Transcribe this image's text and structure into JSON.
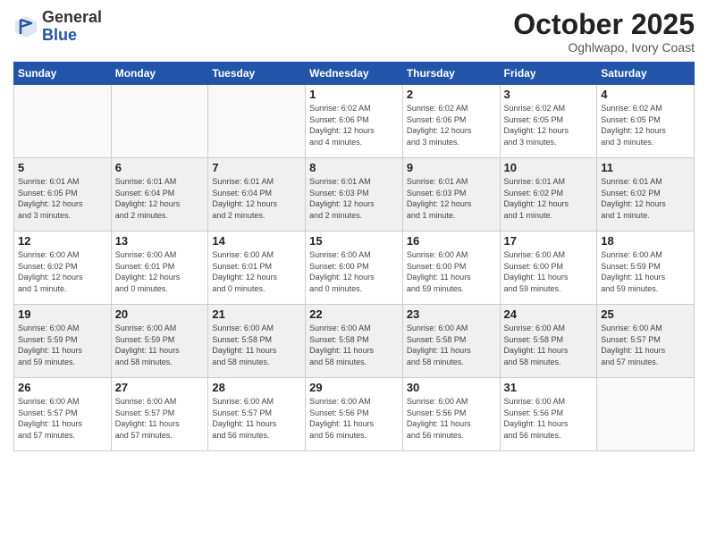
{
  "logo": {
    "general": "General",
    "blue": "Blue"
  },
  "header": {
    "month": "October 2025",
    "location": "Oghlwapo, Ivory Coast"
  },
  "weekdays": [
    "Sunday",
    "Monday",
    "Tuesday",
    "Wednesday",
    "Thursday",
    "Friday",
    "Saturday"
  ],
  "weeks": [
    [
      {
        "day": "",
        "info": ""
      },
      {
        "day": "",
        "info": ""
      },
      {
        "day": "",
        "info": ""
      },
      {
        "day": "1",
        "info": "Sunrise: 6:02 AM\nSunset: 6:06 PM\nDaylight: 12 hours\nand 4 minutes."
      },
      {
        "day": "2",
        "info": "Sunrise: 6:02 AM\nSunset: 6:06 PM\nDaylight: 12 hours\nand 3 minutes."
      },
      {
        "day": "3",
        "info": "Sunrise: 6:02 AM\nSunset: 6:05 PM\nDaylight: 12 hours\nand 3 minutes."
      },
      {
        "day": "4",
        "info": "Sunrise: 6:02 AM\nSunset: 6:05 PM\nDaylight: 12 hours\nand 3 minutes."
      }
    ],
    [
      {
        "day": "5",
        "info": "Sunrise: 6:01 AM\nSunset: 6:05 PM\nDaylight: 12 hours\nand 3 minutes."
      },
      {
        "day": "6",
        "info": "Sunrise: 6:01 AM\nSunset: 6:04 PM\nDaylight: 12 hours\nand 2 minutes."
      },
      {
        "day": "7",
        "info": "Sunrise: 6:01 AM\nSunset: 6:04 PM\nDaylight: 12 hours\nand 2 minutes."
      },
      {
        "day": "8",
        "info": "Sunrise: 6:01 AM\nSunset: 6:03 PM\nDaylight: 12 hours\nand 2 minutes."
      },
      {
        "day": "9",
        "info": "Sunrise: 6:01 AM\nSunset: 6:03 PM\nDaylight: 12 hours\nand 1 minute."
      },
      {
        "day": "10",
        "info": "Sunrise: 6:01 AM\nSunset: 6:02 PM\nDaylight: 12 hours\nand 1 minute."
      },
      {
        "day": "11",
        "info": "Sunrise: 6:01 AM\nSunset: 6:02 PM\nDaylight: 12 hours\nand 1 minute."
      }
    ],
    [
      {
        "day": "12",
        "info": "Sunrise: 6:00 AM\nSunset: 6:02 PM\nDaylight: 12 hours\nand 1 minute."
      },
      {
        "day": "13",
        "info": "Sunrise: 6:00 AM\nSunset: 6:01 PM\nDaylight: 12 hours\nand 0 minutes."
      },
      {
        "day": "14",
        "info": "Sunrise: 6:00 AM\nSunset: 6:01 PM\nDaylight: 12 hours\nand 0 minutes."
      },
      {
        "day": "15",
        "info": "Sunrise: 6:00 AM\nSunset: 6:00 PM\nDaylight: 12 hours\nand 0 minutes."
      },
      {
        "day": "16",
        "info": "Sunrise: 6:00 AM\nSunset: 6:00 PM\nDaylight: 11 hours\nand 59 minutes."
      },
      {
        "day": "17",
        "info": "Sunrise: 6:00 AM\nSunset: 6:00 PM\nDaylight: 11 hours\nand 59 minutes."
      },
      {
        "day": "18",
        "info": "Sunrise: 6:00 AM\nSunset: 5:59 PM\nDaylight: 11 hours\nand 59 minutes."
      }
    ],
    [
      {
        "day": "19",
        "info": "Sunrise: 6:00 AM\nSunset: 5:59 PM\nDaylight: 11 hours\nand 59 minutes."
      },
      {
        "day": "20",
        "info": "Sunrise: 6:00 AM\nSunset: 5:59 PM\nDaylight: 11 hours\nand 58 minutes."
      },
      {
        "day": "21",
        "info": "Sunrise: 6:00 AM\nSunset: 5:58 PM\nDaylight: 11 hours\nand 58 minutes."
      },
      {
        "day": "22",
        "info": "Sunrise: 6:00 AM\nSunset: 5:58 PM\nDaylight: 11 hours\nand 58 minutes."
      },
      {
        "day": "23",
        "info": "Sunrise: 6:00 AM\nSunset: 5:58 PM\nDaylight: 11 hours\nand 58 minutes."
      },
      {
        "day": "24",
        "info": "Sunrise: 6:00 AM\nSunset: 5:58 PM\nDaylight: 11 hours\nand 58 minutes."
      },
      {
        "day": "25",
        "info": "Sunrise: 6:00 AM\nSunset: 5:57 PM\nDaylight: 11 hours\nand 57 minutes."
      }
    ],
    [
      {
        "day": "26",
        "info": "Sunrise: 6:00 AM\nSunset: 5:57 PM\nDaylight: 11 hours\nand 57 minutes."
      },
      {
        "day": "27",
        "info": "Sunrise: 6:00 AM\nSunset: 5:57 PM\nDaylight: 11 hours\nand 57 minutes."
      },
      {
        "day": "28",
        "info": "Sunrise: 6:00 AM\nSunset: 5:57 PM\nDaylight: 11 hours\nand 56 minutes."
      },
      {
        "day": "29",
        "info": "Sunrise: 6:00 AM\nSunset: 5:56 PM\nDaylight: 11 hours\nand 56 minutes."
      },
      {
        "day": "30",
        "info": "Sunrise: 6:00 AM\nSunset: 5:56 PM\nDaylight: 11 hours\nand 56 minutes."
      },
      {
        "day": "31",
        "info": "Sunrise: 6:00 AM\nSunset: 5:56 PM\nDaylight: 11 hours\nand 56 minutes."
      },
      {
        "day": "",
        "info": ""
      }
    ]
  ]
}
